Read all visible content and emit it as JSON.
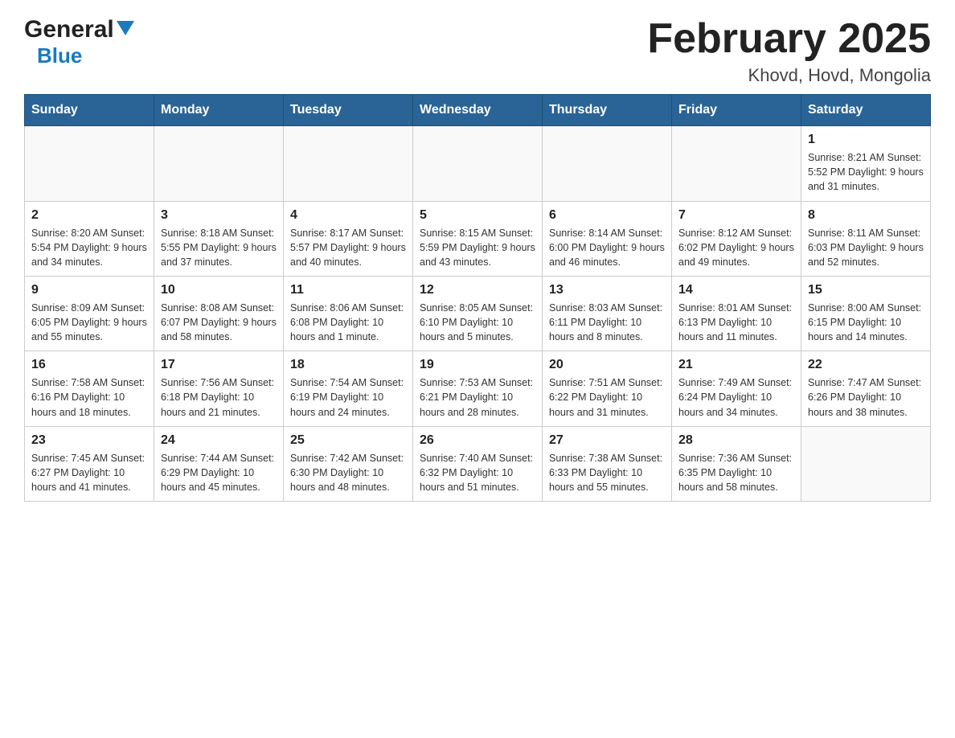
{
  "header": {
    "logo_general": "General",
    "logo_blue": "Blue",
    "title": "February 2025",
    "subtitle": "Khovd, Hovd, Mongolia"
  },
  "weekdays": [
    "Sunday",
    "Monday",
    "Tuesday",
    "Wednesday",
    "Thursday",
    "Friday",
    "Saturday"
  ],
  "weeks": [
    [
      {
        "day": "",
        "info": ""
      },
      {
        "day": "",
        "info": ""
      },
      {
        "day": "",
        "info": ""
      },
      {
        "day": "",
        "info": ""
      },
      {
        "day": "",
        "info": ""
      },
      {
        "day": "",
        "info": ""
      },
      {
        "day": "1",
        "info": "Sunrise: 8:21 AM\nSunset: 5:52 PM\nDaylight: 9 hours and 31 minutes."
      }
    ],
    [
      {
        "day": "2",
        "info": "Sunrise: 8:20 AM\nSunset: 5:54 PM\nDaylight: 9 hours and 34 minutes."
      },
      {
        "day": "3",
        "info": "Sunrise: 8:18 AM\nSunset: 5:55 PM\nDaylight: 9 hours and 37 minutes."
      },
      {
        "day": "4",
        "info": "Sunrise: 8:17 AM\nSunset: 5:57 PM\nDaylight: 9 hours and 40 minutes."
      },
      {
        "day": "5",
        "info": "Sunrise: 8:15 AM\nSunset: 5:59 PM\nDaylight: 9 hours and 43 minutes."
      },
      {
        "day": "6",
        "info": "Sunrise: 8:14 AM\nSunset: 6:00 PM\nDaylight: 9 hours and 46 minutes."
      },
      {
        "day": "7",
        "info": "Sunrise: 8:12 AM\nSunset: 6:02 PM\nDaylight: 9 hours and 49 minutes."
      },
      {
        "day": "8",
        "info": "Sunrise: 8:11 AM\nSunset: 6:03 PM\nDaylight: 9 hours and 52 minutes."
      }
    ],
    [
      {
        "day": "9",
        "info": "Sunrise: 8:09 AM\nSunset: 6:05 PM\nDaylight: 9 hours and 55 minutes."
      },
      {
        "day": "10",
        "info": "Sunrise: 8:08 AM\nSunset: 6:07 PM\nDaylight: 9 hours and 58 minutes."
      },
      {
        "day": "11",
        "info": "Sunrise: 8:06 AM\nSunset: 6:08 PM\nDaylight: 10 hours and 1 minute."
      },
      {
        "day": "12",
        "info": "Sunrise: 8:05 AM\nSunset: 6:10 PM\nDaylight: 10 hours and 5 minutes."
      },
      {
        "day": "13",
        "info": "Sunrise: 8:03 AM\nSunset: 6:11 PM\nDaylight: 10 hours and 8 minutes."
      },
      {
        "day": "14",
        "info": "Sunrise: 8:01 AM\nSunset: 6:13 PM\nDaylight: 10 hours and 11 minutes."
      },
      {
        "day": "15",
        "info": "Sunrise: 8:00 AM\nSunset: 6:15 PM\nDaylight: 10 hours and 14 minutes."
      }
    ],
    [
      {
        "day": "16",
        "info": "Sunrise: 7:58 AM\nSunset: 6:16 PM\nDaylight: 10 hours and 18 minutes."
      },
      {
        "day": "17",
        "info": "Sunrise: 7:56 AM\nSunset: 6:18 PM\nDaylight: 10 hours and 21 minutes."
      },
      {
        "day": "18",
        "info": "Sunrise: 7:54 AM\nSunset: 6:19 PM\nDaylight: 10 hours and 24 minutes."
      },
      {
        "day": "19",
        "info": "Sunrise: 7:53 AM\nSunset: 6:21 PM\nDaylight: 10 hours and 28 minutes."
      },
      {
        "day": "20",
        "info": "Sunrise: 7:51 AM\nSunset: 6:22 PM\nDaylight: 10 hours and 31 minutes."
      },
      {
        "day": "21",
        "info": "Sunrise: 7:49 AM\nSunset: 6:24 PM\nDaylight: 10 hours and 34 minutes."
      },
      {
        "day": "22",
        "info": "Sunrise: 7:47 AM\nSunset: 6:26 PM\nDaylight: 10 hours and 38 minutes."
      }
    ],
    [
      {
        "day": "23",
        "info": "Sunrise: 7:45 AM\nSunset: 6:27 PM\nDaylight: 10 hours and 41 minutes."
      },
      {
        "day": "24",
        "info": "Sunrise: 7:44 AM\nSunset: 6:29 PM\nDaylight: 10 hours and 45 minutes."
      },
      {
        "day": "25",
        "info": "Sunrise: 7:42 AM\nSunset: 6:30 PM\nDaylight: 10 hours and 48 minutes."
      },
      {
        "day": "26",
        "info": "Sunrise: 7:40 AM\nSunset: 6:32 PM\nDaylight: 10 hours and 51 minutes."
      },
      {
        "day": "27",
        "info": "Sunrise: 7:38 AM\nSunset: 6:33 PM\nDaylight: 10 hours and 55 minutes."
      },
      {
        "day": "28",
        "info": "Sunrise: 7:36 AM\nSunset: 6:35 PM\nDaylight: 10 hours and 58 minutes."
      },
      {
        "day": "",
        "info": ""
      }
    ]
  ]
}
